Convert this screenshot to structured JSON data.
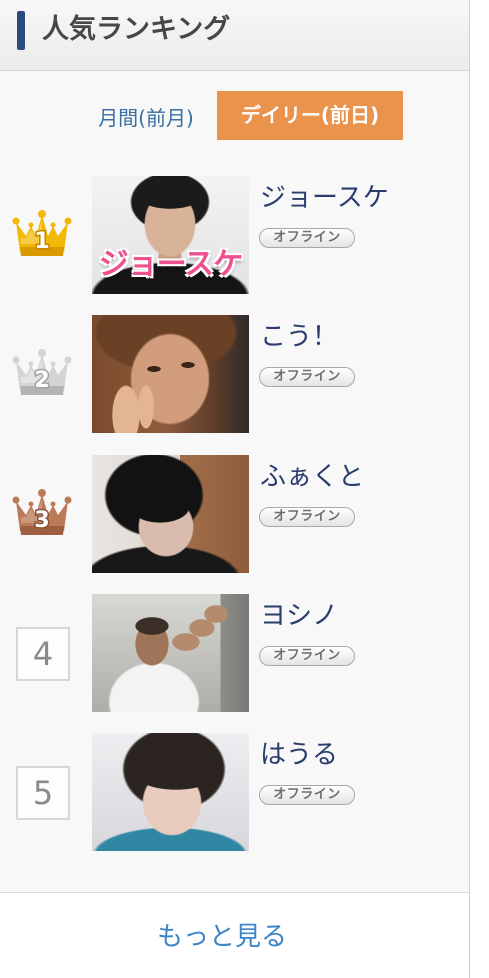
{
  "header": {
    "title": "人気ランキング",
    "accent_color": "#2b4b7c"
  },
  "tabs": [
    {
      "label": "月間(前月)",
      "active": false,
      "color": "#3b6fa4"
    },
    {
      "label": "デイリー(前日)",
      "active": true,
      "color": "#ea934d"
    }
  ],
  "rankings": [
    {
      "rank": "1",
      "icon": "crown-gold-icon",
      "crown_color": "#f3b805",
      "crown_band_color": "#d89a00",
      "number_stroke": "#c48600",
      "name": "ジョースケ",
      "status": "オフライン",
      "photo_text": "ジョースケ"
    },
    {
      "rank": "2",
      "icon": "crown-silver-icon",
      "crown_color": "#d4d4d4",
      "crown_band_color": "#b4b4b4",
      "number_stroke": "#a2a2a2",
      "name": "こう！",
      "status": "オフライン"
    },
    {
      "rank": "3",
      "icon": "crown-bronze-icon",
      "crown_color": "#bc7b58",
      "crown_band_color": "#9c5f41",
      "number_stroke": "#8a5236",
      "name": "ふぁくと",
      "status": "オフライン"
    },
    {
      "rank": "4",
      "name": "ヨシノ",
      "status": "オフライン"
    },
    {
      "rank": "5",
      "name": "はうる",
      "status": "オフライン"
    }
  ],
  "footer": {
    "more_label": "もっと見る",
    "link_color": "#3d85c6"
  }
}
